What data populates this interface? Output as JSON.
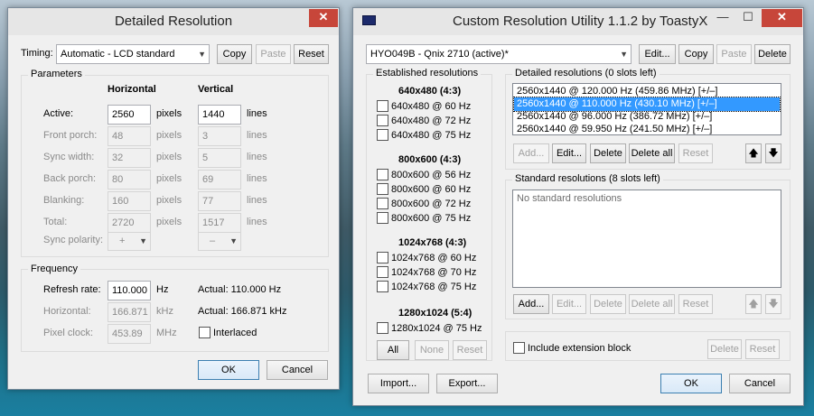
{
  "left": {
    "title": "Detailed Resolution",
    "close": "✕",
    "timing_label": "Timing:",
    "timing_value": "Automatic - LCD standard",
    "copy": "Copy",
    "paste": "Paste",
    "reset": "Reset",
    "params_title": "Parameters",
    "horizontal": "Horizontal",
    "vertical": "Vertical",
    "rows": [
      {
        "label": "Active:",
        "h": "2560",
        "hu": "pixels",
        "v": "1440",
        "vu": "lines"
      },
      {
        "label": "Front porch:",
        "h": "48",
        "hu": "pixels",
        "v": "3",
        "vu": "lines"
      },
      {
        "label": "Sync width:",
        "h": "32",
        "hu": "pixels",
        "v": "5",
        "vu": "lines"
      },
      {
        "label": "Back porch:",
        "h": "80",
        "hu": "pixels",
        "v": "69",
        "vu": "lines"
      },
      {
        "label": "Blanking:",
        "h": "160",
        "hu": "pixels",
        "v": "77",
        "vu": "lines"
      },
      {
        "label": "Total:",
        "h": "2720",
        "hu": "pixels",
        "v": "1517",
        "vu": "lines"
      }
    ],
    "sync_polarity": "Sync polarity:",
    "pol_h": "+",
    "pol_v": "–",
    "freq_title": "Frequency",
    "refresh_label": "Refresh rate:",
    "refresh_value": "110.000",
    "refresh_unit": "Hz",
    "refresh_actual": "Actual: 110.000 Hz",
    "horiz_label": "Horizontal:",
    "horiz_value": "166.871",
    "horiz_unit": "kHz",
    "horiz_actual": "Actual: 166.871 kHz",
    "clock_label": "Pixel clock:",
    "clock_value": "453.89",
    "clock_unit": "MHz",
    "interlaced": "Interlaced",
    "ok": "OK",
    "cancel": "Cancel"
  },
  "right": {
    "title": "Custom Resolution Utility 1.1.2 by ToastyX",
    "minimize": "—",
    "maximize": "☐",
    "close": "✕",
    "monitor": "HYO049B - Qnix 2710 (active)*",
    "edit": "Edit...",
    "copy": "Copy",
    "paste": "Paste",
    "delete": "Delete",
    "established_title": "Established resolutions",
    "groups": [
      {
        "head": "640x480 (4:3)",
        "items": [
          "640x480 @ 60 Hz",
          "640x480 @ 72 Hz",
          "640x480 @ 75 Hz"
        ]
      },
      {
        "head": "800x600 (4:3)",
        "items": [
          "800x600 @ 56 Hz",
          "800x600 @ 60 Hz",
          "800x600 @ 72 Hz",
          "800x600 @ 75 Hz"
        ]
      },
      {
        "head": "1024x768 (4:3)",
        "items": [
          "1024x768 @ 60 Hz",
          "1024x768 @ 70 Hz",
          "1024x768 @ 75 Hz"
        ]
      },
      {
        "head": "1280x1024 (5:4)",
        "items": [
          "1280x1024 @ 75 Hz"
        ]
      }
    ],
    "all": "All",
    "none": "None",
    "reset": "Reset",
    "detailed_title": "Detailed resolutions (0 slots left)",
    "detailed": [
      "2560x1440 @ 120.000 Hz (459.86 MHz) [+/–]",
      "2560x1440 @ 110.000 Hz (430.10 MHz) [+/–]",
      "2560x1440 @ 96.000 Hz (386.72 MHz) [+/–]",
      "2560x1440 @ 59.950 Hz (241.50 MHz) [+/–]"
    ],
    "add": "Add...",
    "edit2": "Edit...",
    "delete2": "Delete",
    "delete_all": "Delete all",
    "reset2": "Reset",
    "up": "🡅",
    "down": "🡇",
    "standard_title": "Standard resolutions (8 slots left)",
    "standard_empty": "No standard resolutions",
    "ext_label": "Include extension block",
    "ext_delete": "Delete",
    "ext_reset": "Reset",
    "import": "Import...",
    "export": "Export...",
    "ok": "OK",
    "cancel": "Cancel"
  }
}
